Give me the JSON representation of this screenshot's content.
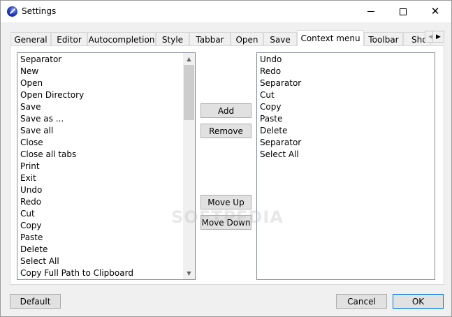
{
  "window": {
    "title": "Settings"
  },
  "titlebar": {
    "minimize": "–",
    "maximize": "□",
    "close": "✕"
  },
  "tabs": [
    {
      "label": "General"
    },
    {
      "label": "Editor"
    },
    {
      "label": "Autocompletion"
    },
    {
      "label": "Style"
    },
    {
      "label": "Tabbar"
    },
    {
      "label": "Open"
    },
    {
      "label": "Save"
    },
    {
      "label": "Context menu",
      "active": true
    },
    {
      "label": "Toolbar"
    },
    {
      "label": "Sho"
    }
  ],
  "available_items": [
    "Separator",
    "New",
    "Open",
    "Open Directory",
    "Save",
    "Save as ...",
    "Save all",
    "Close",
    "Close all tabs",
    "Print",
    "Exit",
    "Undo",
    "Redo",
    "Cut",
    "Copy",
    "Paste",
    "Delete",
    "Select All",
    "Copy Full Path to Clipboard"
  ],
  "selected_items": [
    "Undo",
    "Redo",
    "Separator",
    "Cut",
    "Copy",
    "Paste",
    "Delete",
    "Separator",
    "Select All"
  ],
  "buttons": {
    "add": "Add",
    "remove": "Remove",
    "move_up": "Move Up",
    "move_down": "Move Down",
    "default": "Default",
    "cancel": "Cancel",
    "ok": "OK"
  },
  "watermark": "SOFTPEDIA",
  "colors": {
    "focus_border": "#0078d7",
    "button_face": "#e1e1e1"
  }
}
